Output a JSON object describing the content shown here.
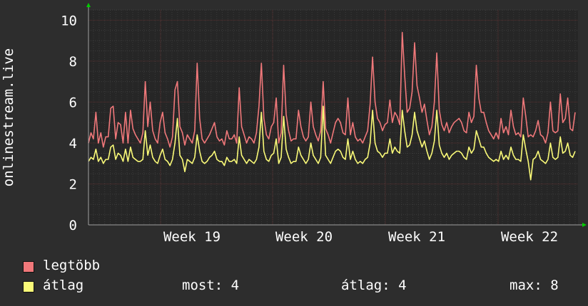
{
  "chart_data": {
    "type": "line",
    "ylabel": "onlinestream.live",
    "ylim": [
      0,
      10.5
    ],
    "yticks": [
      0,
      2,
      4,
      6,
      8,
      10
    ],
    "x_tick_labels": [
      "Week 19",
      "Week 20",
      "Week 21",
      "Week 22"
    ],
    "grid": true,
    "legend_placement": "bottom",
    "colors": {
      "background": "#2d2d2d",
      "plot_background": "#262626",
      "grid": "#474747",
      "text": "#ffffff",
      "axis_arrow": "#00cc00"
    },
    "series": [
      {
        "name": "legtöbb",
        "color": "#f0787a",
        "values": [
          4,
          4.5,
          4.2,
          5.5,
          4,
          4.5,
          3.8,
          4.3,
          4.3,
          5.7,
          5.8,
          4.2,
          5,
          4.9,
          4,
          5.5,
          4,
          5.6,
          4.7,
          4.4,
          4.2,
          4,
          4.5,
          7,
          4.8,
          6,
          4.6,
          4.2,
          4,
          5,
          5.5,
          4.5,
          4.2,
          3.8,
          4.3,
          6.6,
          7,
          4.8,
          4.5,
          3.9,
          4.4,
          4.2,
          4,
          4.6,
          7.9,
          5.2,
          4.2,
          4,
          4.2,
          4.4,
          4.7,
          5,
          4.3,
          4.1,
          4.2,
          3.9,
          4.6,
          4.2,
          4.2,
          4.4,
          4,
          6.7,
          4.8,
          4.4,
          4,
          4.3,
          4.2,
          4,
          4.5,
          5.8,
          7.9,
          5.2,
          4.4,
          4.2,
          4.8,
          5,
          6.2,
          4,
          4.5,
          7.8,
          5.4,
          4.6,
          4.1,
          4.2,
          4.2,
          5.6,
          4.8,
          4.3,
          4.1,
          4.3,
          6,
          4.8,
          4.4,
          4.1,
          4.6,
          7,
          4.7,
          4.4,
          4,
          4.5,
          5,
          5.2,
          5,
          4.5,
          4.4,
          6.2,
          4.4,
          5,
          4.3,
          4.1,
          4.2,
          4,
          4.3,
          4.6,
          5.9,
          8.2,
          6,
          5.2,
          5,
          4.6,
          4.9,
          5,
          6.1,
          5,
          5.5,
          5.3,
          4.9,
          9.4,
          7.3,
          5.5,
          5.7,
          6.5,
          8.9,
          6.8,
          6.2,
          5.5,
          5.9,
          5.1,
          4.4,
          4.8,
          6,
          8.4,
          5.6,
          4.9,
          4.6,
          5,
          4.5,
          4.8,
          5,
          5.1,
          5.2,
          5,
          4.6,
          4.5,
          5.5,
          5,
          5.3,
          7.8,
          6.2,
          5.5,
          5.5,
          5,
          4.6,
          4.4,
          4.2,
          4.5,
          4.2,
          5.2,
          4.5,
          4.8,
          4.4,
          5.6,
          4.8,
          4.4,
          4.5,
          4.3,
          6.2,
          5.3,
          4.3,
          4.4,
          4.3,
          4.6,
          5.1,
          4.4,
          4.3,
          4,
          4.5,
          6,
          4.6,
          4.5,
          4.6,
          6.4,
          5,
          5.2,
          6.2,
          4.7,
          4.6,
          5.5
        ]
      },
      {
        "name": "átlag",
        "color": "#fafa78",
        "values": [
          3.1,
          3.3,
          3.2,
          3.7,
          3.1,
          3.3,
          3,
          3.2,
          3.2,
          3.8,
          3.9,
          3.2,
          3.5,
          3.4,
          3.1,
          3.7,
          3.1,
          3.8,
          3.3,
          3.2,
          3.1,
          3.1,
          3.2,
          4.6,
          3.4,
          3.9,
          3.3,
          3.1,
          3,
          3.4,
          3.7,
          3.2,
          3.1,
          2.9,
          3.2,
          4,
          5.2,
          3.4,
          3.2,
          2.6,
          3.2,
          3.1,
          3,
          3.3,
          4.4,
          3.6,
          3.1,
          3,
          3.1,
          3.3,
          3.4,
          3.6,
          3.2,
          3.1,
          3.1,
          2.9,
          3.3,
          3.1,
          3.1,
          3.2,
          3,
          4.3,
          3.4,
          3.2,
          3,
          3.2,
          3.1,
          3,
          3.2,
          3.8,
          5.5,
          3.6,
          3.2,
          3.1,
          3.4,
          3.5,
          4.2,
          3,
          3.3,
          5.3,
          3.7,
          3.3,
          3,
          3.1,
          3.1,
          3.8,
          3.4,
          3.2,
          3,
          3.2,
          4,
          3.4,
          3.2,
          3,
          3.3,
          5.8,
          3.4,
          3.2,
          3,
          3.3,
          3.6,
          3.7,
          3.6,
          3.3,
          3.2,
          4.2,
          3.2,
          3.6,
          3.2,
          3,
          3.1,
          3,
          3.2,
          3.3,
          4,
          5.6,
          4,
          3.6,
          3.5,
          3.3,
          3.5,
          3.5,
          4.2,
          3.5,
          3.8,
          3.6,
          3.5,
          5.6,
          4.6,
          3.8,
          3.9,
          4.4,
          5.5,
          4.6,
          4.2,
          3.8,
          4.1,
          3.6,
          3.2,
          3.5,
          4.1,
          5.6,
          3.9,
          3.5,
          3.3,
          3.5,
          3.2,
          3.4,
          3.5,
          3.6,
          3.6,
          3.5,
          3.3,
          3.2,
          3.8,
          3.5,
          3.7,
          4.6,
          4.2,
          3.8,
          3.8,
          3.5,
          3.3,
          3.2,
          3.1,
          3.2,
          3.1,
          3.6,
          3.2,
          3.4,
          3.2,
          3.8,
          3.4,
          3.2,
          3.2,
          3.1,
          4.4,
          3.7,
          3.1,
          2.2,
          3.2,
          3.3,
          3.6,
          3.2,
          3.1,
          3,
          3.2,
          4,
          3.3,
          3.2,
          3.3,
          4.3,
          3.5,
          3.6,
          4,
          3.4,
          3.3,
          3.6
        ]
      }
    ]
  },
  "legend": {
    "items": [
      {
        "label": "legtöbb",
        "color": "#f0787a"
      },
      {
        "label": "átlag",
        "color": "#fafa78"
      }
    ],
    "stats": {
      "now": "most: 4",
      "avg": "átlag: 4",
      "max": "max: 8"
    }
  }
}
